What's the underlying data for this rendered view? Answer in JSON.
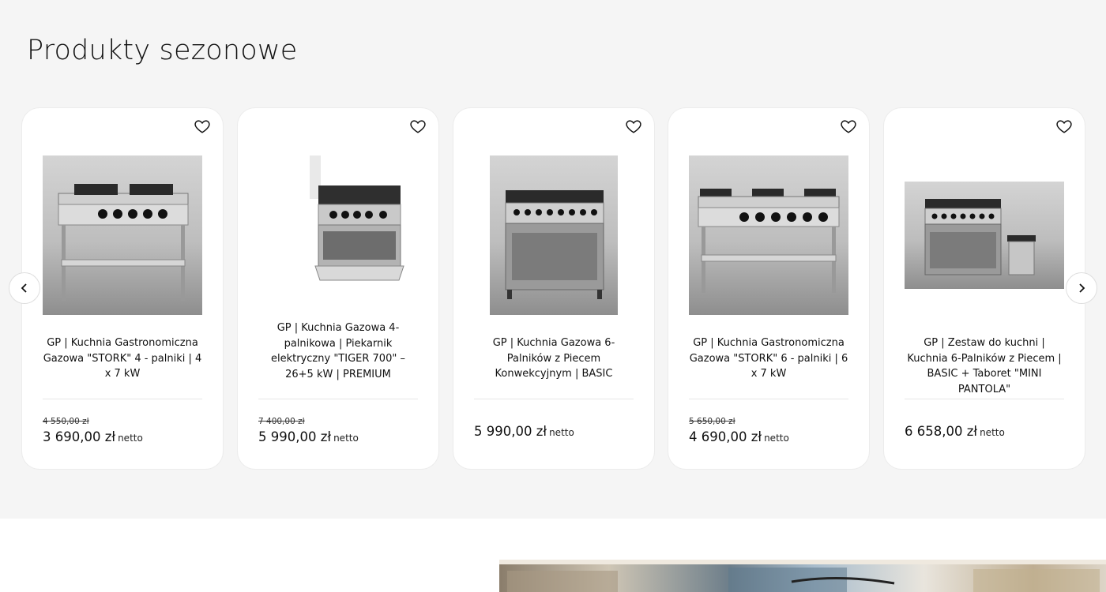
{
  "section": {
    "title": "Produkty sezonowe"
  },
  "products": [
    {
      "title": "GP | Kuchnia Gastronomiczna Gazowa \"STORK\" 4 - palniki | 4 x 7 kW",
      "old_price": "4 550,00 zł",
      "price": "3 690,00 zł",
      "unit": "netto",
      "image_icon": "gas-stove-4-burner-stand"
    },
    {
      "title": "GP | Kuchnia Gazowa 4-palnikowa | Piekarnik elektryczny \"TIGER 700\" – 26+5 kW | PREMIUM",
      "old_price": "7 400,00 zł",
      "price": "5 990,00 zł",
      "unit": "netto",
      "image_icon": "gas-stove-oven-open"
    },
    {
      "title": "GP | Kuchnia Gazowa 6-Palników z Piecem Konwekcyjnym | BASIC",
      "old_price": "",
      "price": "5 990,00 zł",
      "unit": "netto",
      "image_icon": "gas-range-6-burner-oven"
    },
    {
      "title": "GP | Kuchnia Gastronomiczna Gazowa \"STORK\" 6 - palniki | 6 x 7 kW",
      "old_price": "5 650,00 zł",
      "price": "4 690,00 zł",
      "unit": "netto",
      "image_icon": "gas-stove-6-burner-stand"
    },
    {
      "title": "GP | Zestaw do kuchni | Kuchnia 6-Palników z Piecem | BASIC + Taboret \"MINI PANTOLA\"",
      "old_price": "",
      "price": "6 658,00 zł",
      "unit": "netto",
      "image_icon": "gas-range-with-stool"
    }
  ],
  "icons": {
    "favorite": "heart-icon",
    "prev": "chevron-left-icon",
    "next": "chevron-right-icon"
  },
  "colors": {
    "section_bg": "#f5f5f5",
    "card_bg": "#ffffff",
    "text": "#111111"
  }
}
